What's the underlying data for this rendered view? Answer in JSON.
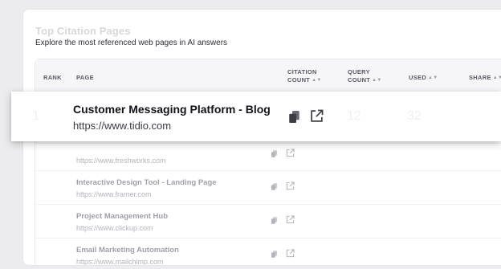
{
  "card": {
    "title": "Top Citation Pages",
    "subtitle": "Explore the most referenced web pages in AI answers"
  },
  "table": {
    "headers": {
      "rank": "RANK",
      "page": "PAGE",
      "citation_count": [
        "CITATION",
        "COUNT"
      ],
      "query_count": [
        "QUERY",
        "COUNT"
      ],
      "used": "USED",
      "share": "SHARE"
    },
    "highlighted_row": {
      "rank": "1",
      "title": "Customer Messaging Platform - Blog",
      "url": "https://www.tidio.com",
      "query_count": "12",
      "used": "32"
    },
    "rows": [
      {
        "title": "",
        "url": "https://www.freshworks.com"
      },
      {
        "title": "Interactive Design Tool - Landing Page",
        "url": "https://www.framer.com"
      },
      {
        "title": "Project Management Hub",
        "url": "https://www.clickup.com"
      },
      {
        "title": "Email Marketing Automation",
        "url": "https://www.mailchimp.com"
      }
    ]
  },
  "icons": {
    "copy": "copy-icon",
    "open_external": "external-link-icon",
    "sort": "sort-arrows-icon"
  },
  "colors": {
    "page_background": "#ececee",
    "card_background": "#ffffff",
    "header_background": "#f6f6f8"
  }
}
